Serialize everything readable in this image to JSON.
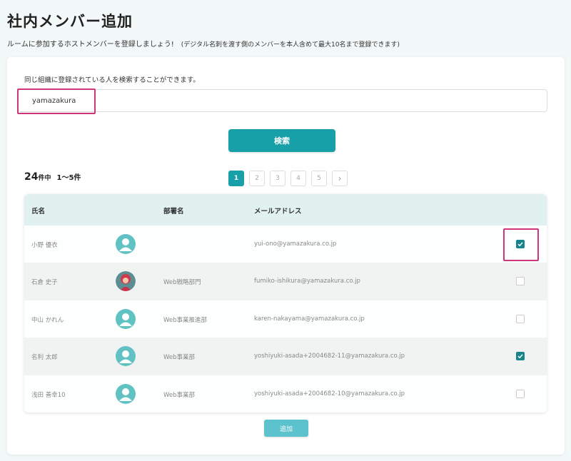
{
  "page": {
    "title": "社内メンバー追加",
    "subtitle": "ルームに参加するホストメンバーを登録しましょう!",
    "note": "(デジタル名刺を渡す側のメンバーを本人含めて最大10名まで登録できます)"
  },
  "search": {
    "hint": "同じ組織に登録されている人を検索することができます。",
    "value": "yamazakura",
    "button_label": "検索"
  },
  "results": {
    "total": "24",
    "total_suffix": "件中",
    "range": "1～5件"
  },
  "pagination": {
    "pages": [
      "1",
      "2",
      "3",
      "4",
      "5"
    ],
    "current": "1",
    "next_symbol": "›"
  },
  "table": {
    "headers": {
      "name": "氏名",
      "department": "部署名",
      "email": "メールアドレス"
    },
    "rows": [
      {
        "name": "小野 優衣",
        "department": "",
        "email": "yui-ono@yamazakura.co.jp",
        "avatar": "person-icon",
        "checked": true
      },
      {
        "name": "石倉 史子",
        "department": "Web戦略部門",
        "email": "fumiko-ishikura@yamazakura.co.jp",
        "avatar": "photo",
        "checked": false
      },
      {
        "name": "中山 かれん",
        "department": "Web事業推進部",
        "email": "karen-nakayama@yamazakura.co.jp",
        "avatar": "person-icon",
        "checked": false
      },
      {
        "name": "名利 太郎",
        "department": "Web事業部",
        "email": "yoshiyuki-asada+2004682-11@yamazakura.co.jp",
        "avatar": "person-icon",
        "checked": true
      },
      {
        "name": "浅田 善幸10",
        "department": "Web事業部",
        "email": "yoshiyuki-asada+2004682-10@yamazakura.co.jp",
        "avatar": "person-icon",
        "checked": false
      }
    ]
  },
  "add_button_label": "追加",
  "colors": {
    "accent": "#17a0a7",
    "highlight": "#d0357a",
    "avatar": "#61c2c4",
    "add_button": "#5bc2ce"
  }
}
